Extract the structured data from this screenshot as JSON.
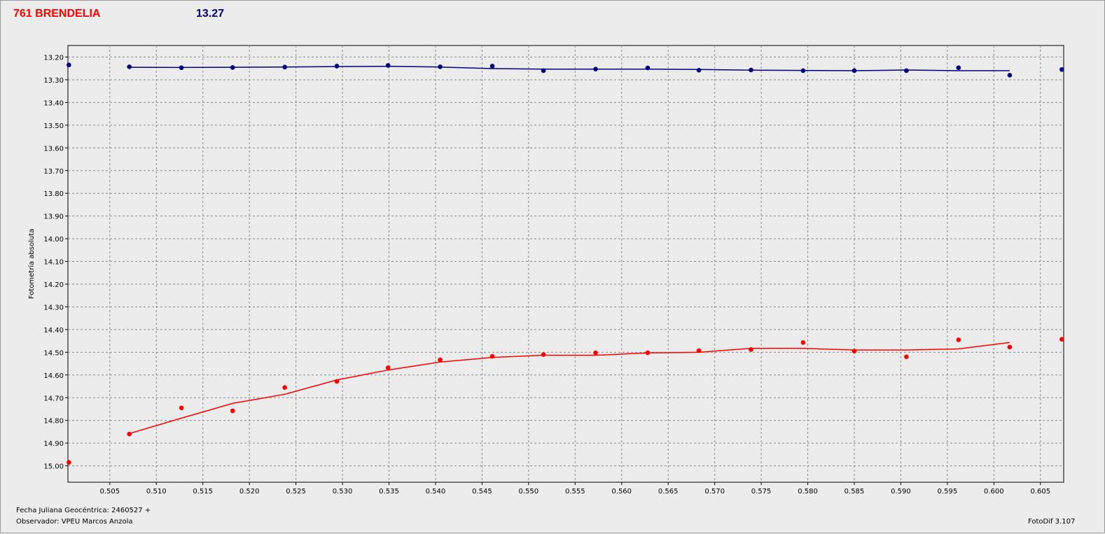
{
  "header": {
    "object_name": "761 BRENDELIA",
    "magnitude": "13.27"
  },
  "footer": {
    "jd_label": "Fecha Juliana Geocéntrica: 2460527 +",
    "observer": "Observador: VPEU Marcos Anzola",
    "software": "FotoDif 3.107"
  },
  "colors": {
    "comparison": "#000080",
    "asteroid": "#ff0000",
    "grid": "#8a8a8a",
    "background": "#ececec"
  },
  "chart_data": {
    "type": "scatter",
    "title": "761 BRENDELIA",
    "subtitle": "13.27",
    "xlabel": "Fecha Juliana Geocéntrica: 2460527 +",
    "ylabel": "Fotometría absoluta",
    "xlim": [
      0.5005,
      0.6075
    ],
    "ylim": [
      13.15,
      15.08
    ],
    "y_inverted": true,
    "grid": true,
    "x_ticks": [
      0.505,
      0.51,
      0.515,
      0.52,
      0.525,
      0.53,
      0.535,
      0.54,
      0.545,
      0.55,
      0.555,
      0.56,
      0.565,
      0.57,
      0.575,
      0.58,
      0.585,
      0.59,
      0.595,
      0.6,
      0.605
    ],
    "x_tick_labels": [
      "0.505",
      "0.510",
      "0.515",
      "0.520",
      "0.525",
      "0.530",
      "0.535",
      "0.540",
      "0.545",
      "0.550",
      "0.555",
      "0.560",
      "0.565",
      "0.570",
      "0.575",
      "0.580",
      "0.585",
      "0.590",
      "0.595",
      "0.600",
      "0.605"
    ],
    "y_ticks": [
      13.2,
      13.3,
      13.4,
      13.5,
      13.6,
      13.7,
      13.8,
      13.9,
      14.0,
      14.1,
      14.2,
      14.3,
      14.4,
      14.5,
      14.6,
      14.7,
      14.8,
      14.9,
      15.0
    ],
    "y_tick_labels": [
      "13.20",
      "13.30",
      "13.40",
      "13.50",
      "13.60",
      "13.70",
      "13.80",
      "13.90",
      "14.00",
      "14.10",
      "14.20",
      "14.30",
      "14.40",
      "14.50",
      "14.60",
      "14.70",
      "14.80",
      "14.90",
      "15.00"
    ],
    "series": [
      {
        "color": "#000080",
        "points": [
          [
            0.5006,
            13.235
          ],
          [
            0.5071,
            13.243
          ],
          [
            0.5127,
            13.247
          ],
          [
            0.5182,
            13.246
          ],
          [
            0.5238,
            13.244
          ],
          [
            0.5294,
            13.24
          ],
          [
            0.5349,
            13.237
          ],
          [
            0.5405,
            13.243
          ],
          [
            0.5461,
            13.24
          ],
          [
            0.5516,
            13.26
          ],
          [
            0.5572,
            13.253
          ],
          [
            0.5628,
            13.248
          ],
          [
            0.5683,
            13.258
          ],
          [
            0.5739,
            13.257
          ],
          [
            0.5795,
            13.26
          ],
          [
            0.585,
            13.26
          ],
          [
            0.5906,
            13.26
          ],
          [
            0.5962,
            13.247
          ],
          [
            0.6017,
            13.28
          ],
          [
            0.6073,
            13.255
          ]
        ],
        "trend": [
          [
            0.5071,
            13.245
          ],
          [
            0.5127,
            13.246
          ],
          [
            0.5182,
            13.245
          ],
          [
            0.5238,
            13.244
          ],
          [
            0.5294,
            13.242
          ],
          [
            0.5349,
            13.241
          ],
          [
            0.5405,
            13.244
          ],
          [
            0.5461,
            13.251
          ],
          [
            0.5516,
            13.253
          ],
          [
            0.5572,
            13.253
          ],
          [
            0.5628,
            13.253
          ],
          [
            0.5683,
            13.255
          ],
          [
            0.5739,
            13.258
          ],
          [
            0.5795,
            13.259
          ],
          [
            0.585,
            13.26
          ],
          [
            0.5906,
            13.257
          ],
          [
            0.5962,
            13.26
          ],
          [
            0.6017,
            13.26
          ]
        ]
      },
      {
        "color": "#ff0000",
        "points": [
          [
            0.5006,
            14.985
          ],
          [
            0.5071,
            14.86
          ],
          [
            0.5127,
            14.745
          ],
          [
            0.5182,
            14.758
          ],
          [
            0.5238,
            14.655
          ],
          [
            0.5294,
            14.628
          ],
          [
            0.5349,
            14.568
          ],
          [
            0.5405,
            14.533
          ],
          [
            0.5461,
            14.518
          ],
          [
            0.5516,
            14.51
          ],
          [
            0.5572,
            14.502
          ],
          [
            0.5628,
            14.502
          ],
          [
            0.5683,
            14.493
          ],
          [
            0.5739,
            14.488
          ],
          [
            0.5795,
            14.457
          ],
          [
            0.585,
            14.495
          ],
          [
            0.5906,
            14.52
          ],
          [
            0.5962,
            14.445
          ],
          [
            0.6017,
            14.477
          ],
          [
            0.6073,
            14.443
          ]
        ],
        "trend": [
          [
            0.5071,
            14.858
          ],
          [
            0.5127,
            14.79
          ],
          [
            0.5182,
            14.725
          ],
          [
            0.5238,
            14.685
          ],
          [
            0.5294,
            14.622
          ],
          [
            0.5349,
            14.578
          ],
          [
            0.5405,
            14.543
          ],
          [
            0.5461,
            14.523
          ],
          [
            0.5516,
            14.513
          ],
          [
            0.5572,
            14.513
          ],
          [
            0.5628,
            14.503
          ],
          [
            0.5683,
            14.5
          ],
          [
            0.5739,
            14.483
          ],
          [
            0.5795,
            14.483
          ],
          [
            0.585,
            14.49
          ],
          [
            0.5906,
            14.49
          ],
          [
            0.5962,
            14.485
          ],
          [
            0.6017,
            14.457
          ]
        ]
      }
    ]
  }
}
